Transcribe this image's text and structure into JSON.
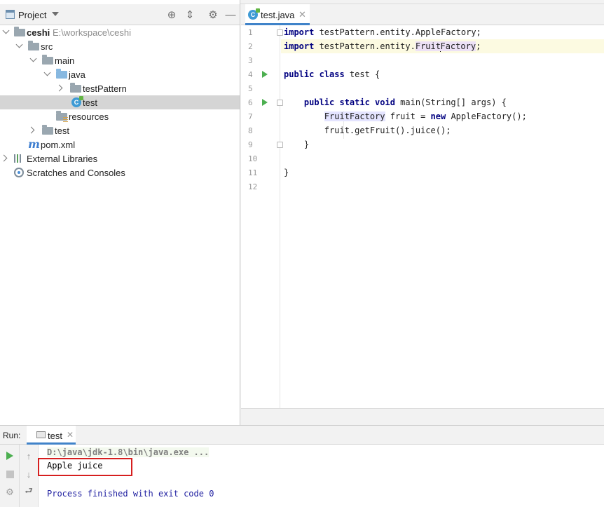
{
  "project_panel": {
    "title": "Project",
    "tree": [
      {
        "label": "ceshi",
        "path": "E:\\workspace\\ceshi"
      },
      {
        "label": "src"
      },
      {
        "label": "main"
      },
      {
        "label": "java"
      },
      {
        "label": "testPattern"
      },
      {
        "label": "test",
        "selected": true
      },
      {
        "label": "resources"
      },
      {
        "label": "test"
      },
      {
        "label": "pom.xml"
      },
      {
        "label": "External Libraries"
      },
      {
        "label": "Scratches and Consoles"
      }
    ]
  },
  "editor": {
    "tab_label": "test.java",
    "line_numbers": [
      "1",
      "2",
      "3",
      "4",
      "5",
      "6",
      "7",
      "8",
      "9",
      "10",
      "11",
      "12"
    ],
    "code": {
      "l1_kw": "import",
      "l1_rest": " testPattern.entity.AppleFactory;",
      "l2_kw": "import",
      "l2_a": " testPattern.entity.",
      "l2_b": "Fruit",
      "l2_c": "Factory",
      "l2_d": ";",
      "l4_kw": "public class",
      "l4_rest": " test {",
      "l6_kw": "public static void",
      "l6_rest": " main(String[] args) {",
      "l7_type": "FruitFactory",
      "l7_a": " fruit = ",
      "l7_kw": "new",
      "l7_b": " AppleFactory();",
      "l8": "fruit.getFruit().juice();",
      "l9": "}",
      "l11": "}"
    }
  },
  "run_panel": {
    "label": "Run:",
    "tab_label": "test",
    "console": {
      "command": "D:\\java\\jdk-1.8\\bin\\java.exe ...",
      "output": "Apple juice",
      "exit": "Process finished with exit code 0"
    }
  },
  "colors": {
    "accent": "#4083c9",
    "keyword": "#000080",
    "highlight_box": "#d61f1f",
    "run_green": "#4caf50"
  }
}
